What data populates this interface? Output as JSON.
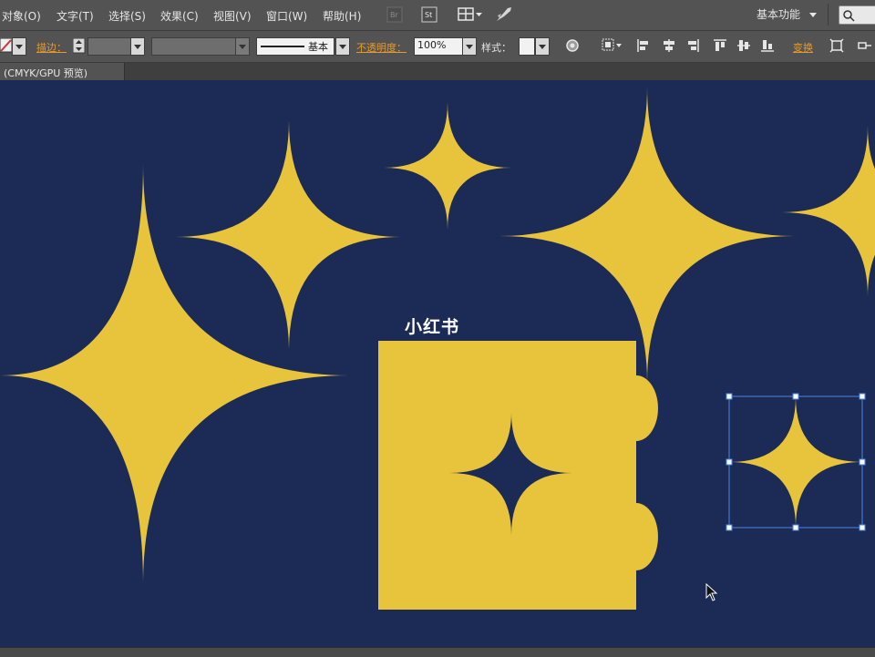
{
  "menu": {
    "items": [
      "对象(O)",
      "文字(T)",
      "选择(S)",
      "效果(C)",
      "视图(V)",
      "窗口(W)",
      "帮助(H)"
    ],
    "workspace": "基本功能"
  },
  "control_bar": {
    "stroke_label": "描边：",
    "stroke_style": "基本",
    "opacity_label": "不透明度：",
    "opacity_value": "100%",
    "style_label": "样式：",
    "transform_label": "变换"
  },
  "document_tab": {
    "label": "(CMYK/GPU 预览)"
  },
  "canvas": {
    "artboard_label": "小红书"
  },
  "colors": {
    "canvas_bg": "#1b2b55",
    "shape_fill": "#e8c33c",
    "selection": "#4a86e8",
    "chrome": "#535353",
    "accent_label": "#e89a2e"
  }
}
